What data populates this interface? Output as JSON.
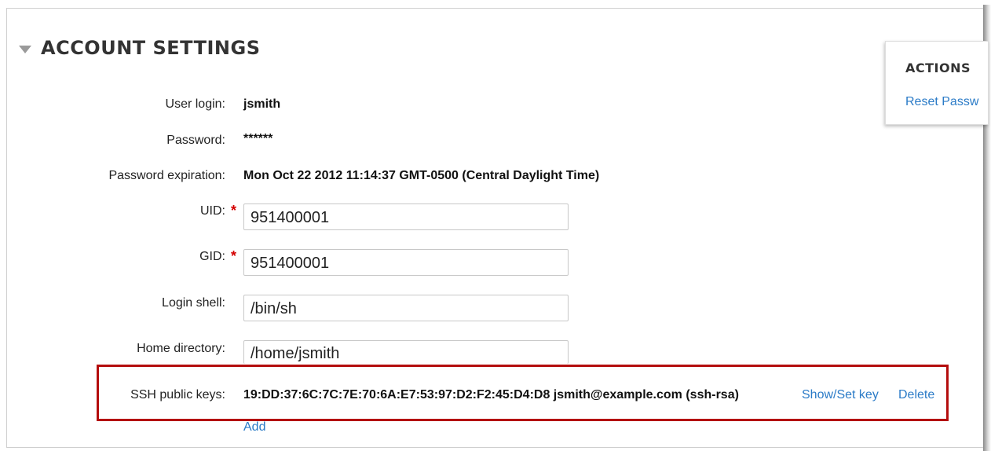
{
  "section": {
    "title": "ACCOUNT SETTINGS"
  },
  "fields": {
    "user_login": {
      "label": "User login:",
      "value": "jsmith"
    },
    "password": {
      "label": "Password:",
      "value": "******"
    },
    "password_expiration": {
      "label": "Password expiration:",
      "value": "Mon Oct 22 2012 11:14:37 GMT-0500 (Central Daylight Time)"
    },
    "uid": {
      "label": "UID:",
      "required_mark": "*",
      "value": "951400001"
    },
    "gid": {
      "label": "GID:",
      "required_mark": "*",
      "value": "951400001"
    },
    "login_shell": {
      "label": "Login shell:",
      "value": "/bin/sh"
    },
    "home_directory": {
      "label": "Home directory:",
      "value": "/home/jsmith"
    }
  },
  "ssh": {
    "label": "SSH public keys:",
    "key_value": "19:DD:37:6C:7C:7E:70:6A:E7:53:97:D2:F2:45:D4:D8 jsmith@example.com (ssh-rsa)",
    "show_set_key_label": "Show/Set key",
    "delete_label": "Delete",
    "add_label": "Add"
  },
  "actions": {
    "title": "ACTIONS",
    "reset_password_label": "Reset Passw"
  },
  "colors": {
    "link": "#2b7bc7",
    "required": "#d40000",
    "highlight_border": "#b40d0d"
  },
  "icons": {
    "collapse": "triangle-down-icon"
  }
}
